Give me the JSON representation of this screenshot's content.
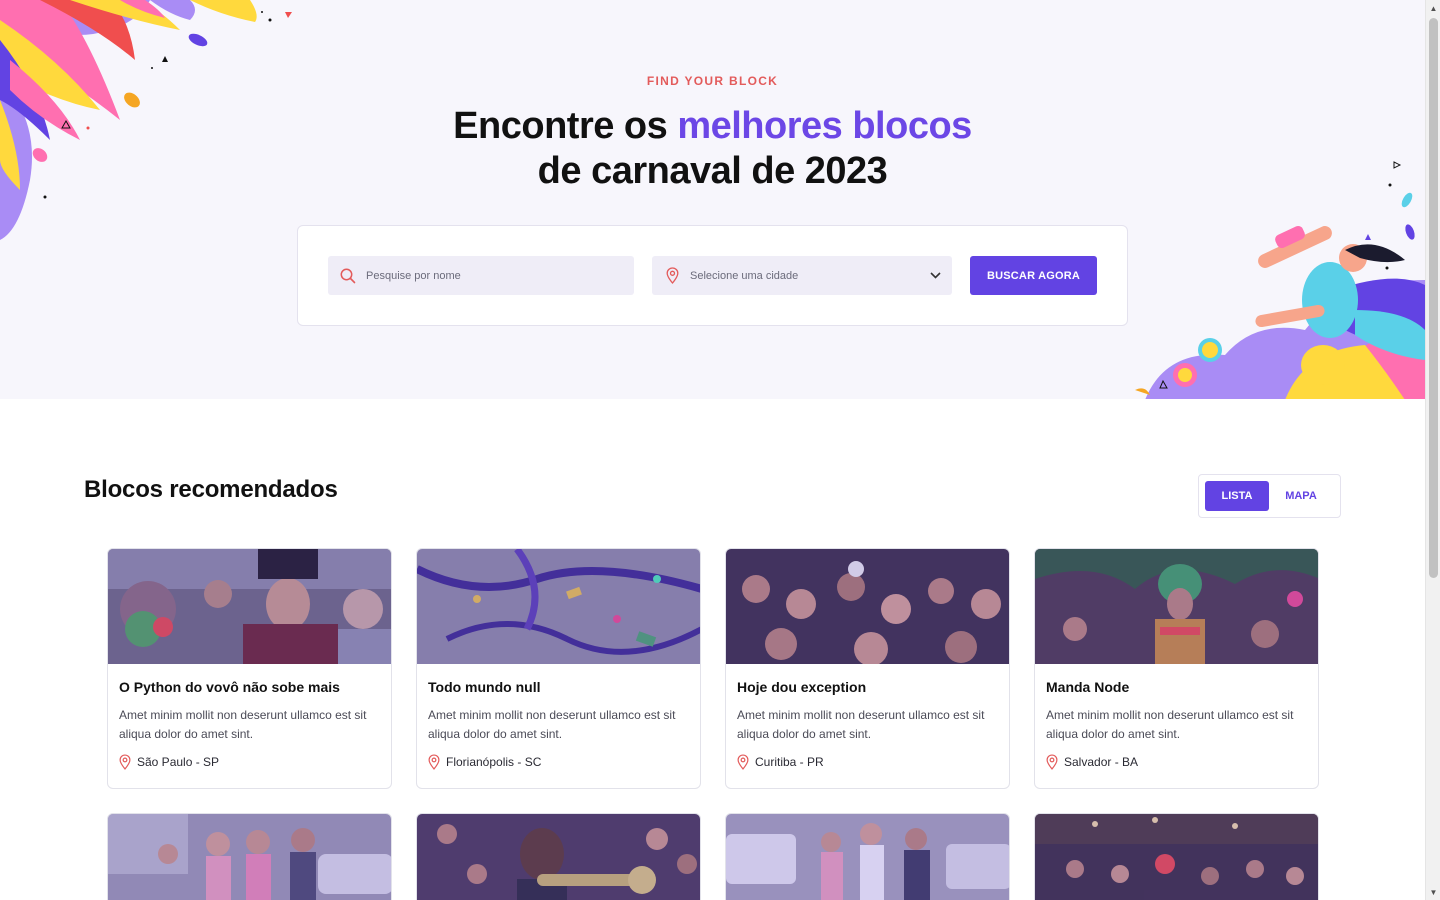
{
  "hero": {
    "eyebrow": "FIND YOUR BLOCK",
    "title_line1_prefix": "Encontre os ",
    "title_line1_accent": "melhores blocos",
    "title_line2": "de carnaval de 2023"
  },
  "search": {
    "name_placeholder": "Pesquise por nome",
    "city_placeholder": "Selecione uma cidade",
    "button_label": "BUSCAR AGORA"
  },
  "section": {
    "title": "Blocos recomendados",
    "view_toggle": {
      "list_label": "LISTA",
      "map_label": "MAPA",
      "active": "LISTA"
    }
  },
  "cards": [
    {
      "title": "O Python do vovô não sobe mais",
      "description": "Amet minim mollit non deserunt ullamco est sit aliqua dolor do amet sint.",
      "location": "São Paulo - SP"
    },
    {
      "title": "Todo mundo null",
      "description": "Amet minim mollit non deserunt ullamco est sit aliqua dolor do amet sint.",
      "location": "Florianópolis - SC"
    },
    {
      "title": "Hoje dou exception",
      "description": "Amet minim mollit non deserunt ullamco est sit aliqua dolor do amet sint.",
      "location": "Curitiba - PR"
    },
    {
      "title": "Manda Node",
      "description": "Amet minim mollit non deserunt ullamco est sit aliqua dolor do amet sint.",
      "location": "Salvador - BA"
    }
  ],
  "colors": {
    "accent": "#6243e3",
    "eyebrow": "#e35b5b",
    "hero_bg": "#f7f6fc",
    "pin": "#e35b5b"
  },
  "icons": {
    "search_field": "search-icon",
    "city_field": "map-pin-icon",
    "dropdown": "chevron-down-icon",
    "card_location": "map-pin-icon"
  }
}
